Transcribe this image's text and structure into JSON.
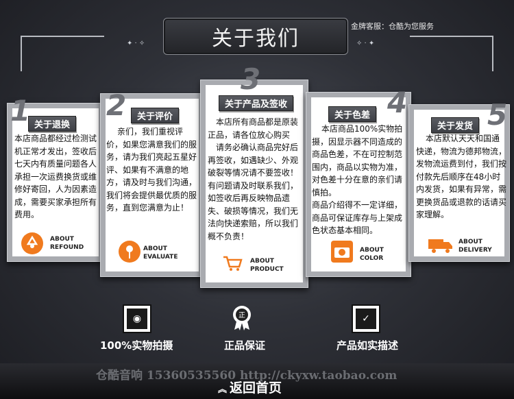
{
  "header": {
    "title": "关于我们",
    "slogan": "金牌客服：仓酷为您服务"
  },
  "cards": [
    {
      "number": "1",
      "tag": "关于退换",
      "body": "本店商品都经过检测试机正常才发出，签收后七天内有质量问题各人承担一次运费换货或维修好寄回，人为因素造成，需要买家承担所有费用。",
      "en_1": "ABOUT",
      "en_2": "REFOUND",
      "icon": "recycle-icon"
    },
    {
      "number": "2",
      "tag": "关于评价",
      "body": "亲们，我们重视评价，如果您满意我们的服务，请为我们亮起五星好评、如果有不满意的地方，请及时与我们沟通，我们将会提供最优质的服务，直到您满意为止！",
      "en_1": "ABOUT",
      "en_2": "EVALUATE",
      "icon": "flower-icon"
    },
    {
      "number": "3",
      "tag": "关于产品及签收",
      "body_1": "本店所有商品都是原装正品，请各位放心购买",
      "body_2": "请务必确认商品完好后再签收，如遇缺少、外观破裂等情况请不要签收！有问题请及时联系我们，如签收后再反映物品遗失、破损等情况，我们无法向快递索赔，所以我们概不负责！",
      "en_1": "ABOUT",
      "en_2": "PRODUCT",
      "icon": "cart-icon"
    },
    {
      "number": "4",
      "tag": "关于色差",
      "body_1": "本店商品100%实物拍摄，因显示器不同造成的商品色差，不在可控制范围内，商品以实物为准，对色差十分在意的亲们请慎拍。",
      "body_2": "商品介绍得不一定详细，商品可保证库存与上架成色状态基本相同。",
      "en_1": "ABOUT",
      "en_2": "COLOR",
      "icon": "camera-icon"
    },
    {
      "number": "5",
      "tag": "关于发货",
      "body": "本店默认天天和国通快递，物流为德邦物流，发物流运费到付，我们按付款先后顺序在48小时内发货，如果有异常，需更换货品或退款的话请买家理解。",
      "en_1": "ABOUT",
      "en_2": "DELIVERY",
      "icon": "truck-icon"
    }
  ],
  "features": [
    {
      "label": "100%实物拍摄",
      "icon": "camera-icon"
    },
    {
      "label": "正品保证",
      "icon": "certificate-icon"
    },
    {
      "label": "产品如实描述",
      "icon": "checklist-icon"
    }
  ],
  "footer": {
    "contact": "仓酷音响 15360535560 http://ckyxw.taobao.com",
    "back_home": "返回首页"
  },
  "colors": {
    "icon_orange": "#f07a1e",
    "card_frame": "#a9abb0",
    "background_dark": "#2f3138"
  }
}
